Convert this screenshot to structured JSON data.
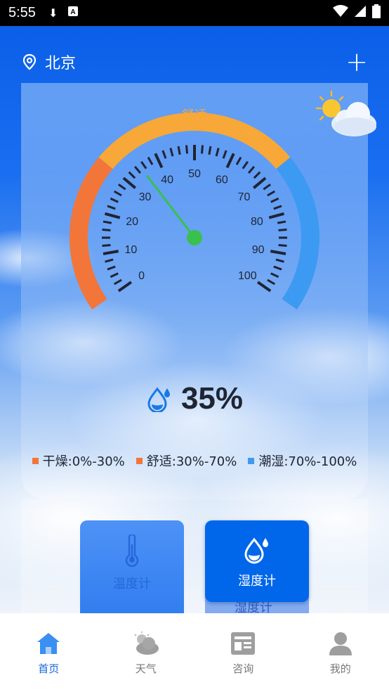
{
  "status_bar": {
    "time": "5:55"
  },
  "header": {
    "city": "北京",
    "add_label": "+"
  },
  "gauge": {
    "zone_labels": {
      "dry": "干燥",
      "comfortable": "舒适",
      "humid": "潮湿"
    },
    "tick_labels": [
      "0",
      "10",
      "20",
      "30",
      "40",
      "50",
      "60",
      "70",
      "80",
      "90",
      "100"
    ],
    "value": 35,
    "zone_colors": {
      "dry": "#f2763a",
      "comfortable": "#f7a838",
      "humid": "#3d9af2"
    },
    "needle_color": "#39c04e"
  },
  "reading": {
    "value": "35%"
  },
  "legend": [
    {
      "label": "干燥:0%-30%",
      "color": "#f2763a"
    },
    {
      "label": "舒适:30%-70%",
      "color": "#f2763a"
    },
    {
      "label": "潮湿:70%-100%",
      "color": "#3d9af2"
    }
  ],
  "tools": {
    "thermometer_label": "温度计",
    "hygrometer_label": "湿度计"
  },
  "tabs": [
    {
      "label": "首页",
      "icon": "home-icon",
      "active": true
    },
    {
      "label": "天气",
      "icon": "cloud-sun-icon",
      "active": false
    },
    {
      "label": "咨询",
      "icon": "news-icon",
      "active": false
    },
    {
      "label": "我的",
      "icon": "person-icon",
      "active": false
    }
  ]
}
